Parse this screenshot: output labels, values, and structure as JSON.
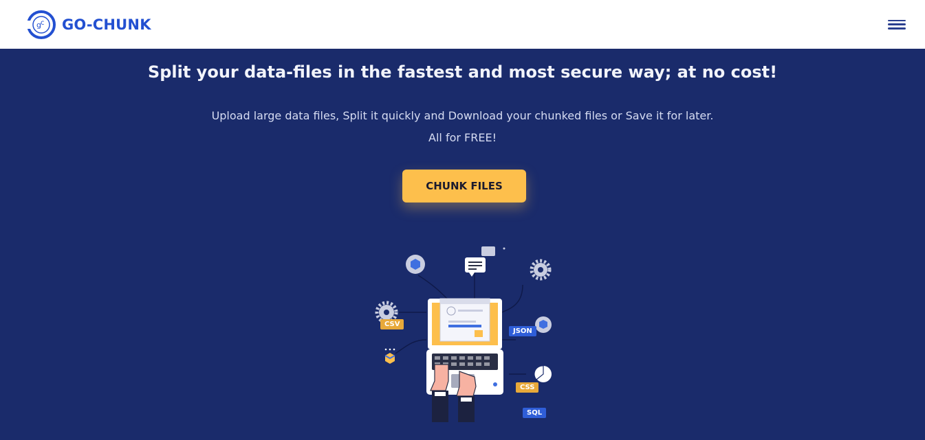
{
  "nav": {
    "brand_name": "GO-CHUNK",
    "logo_letters": "gc"
  },
  "hero": {
    "title": "Split your data-files in the fastest and most secure way; at no cost!",
    "subtitle_line1": "Upload large data files, Split it quickly and Download your chunked files or Save it for later.",
    "subtitle_line2": "All for FREE!",
    "cta_label": "CHUNK FILES"
  },
  "illustration": {
    "tags": [
      "CSV",
      "JSON",
      "CSS",
      "SQL"
    ]
  },
  "colors": {
    "brand": "#2350d1",
    "hero_bg": "#1a2b6b",
    "cta": "#fdbf4c"
  }
}
